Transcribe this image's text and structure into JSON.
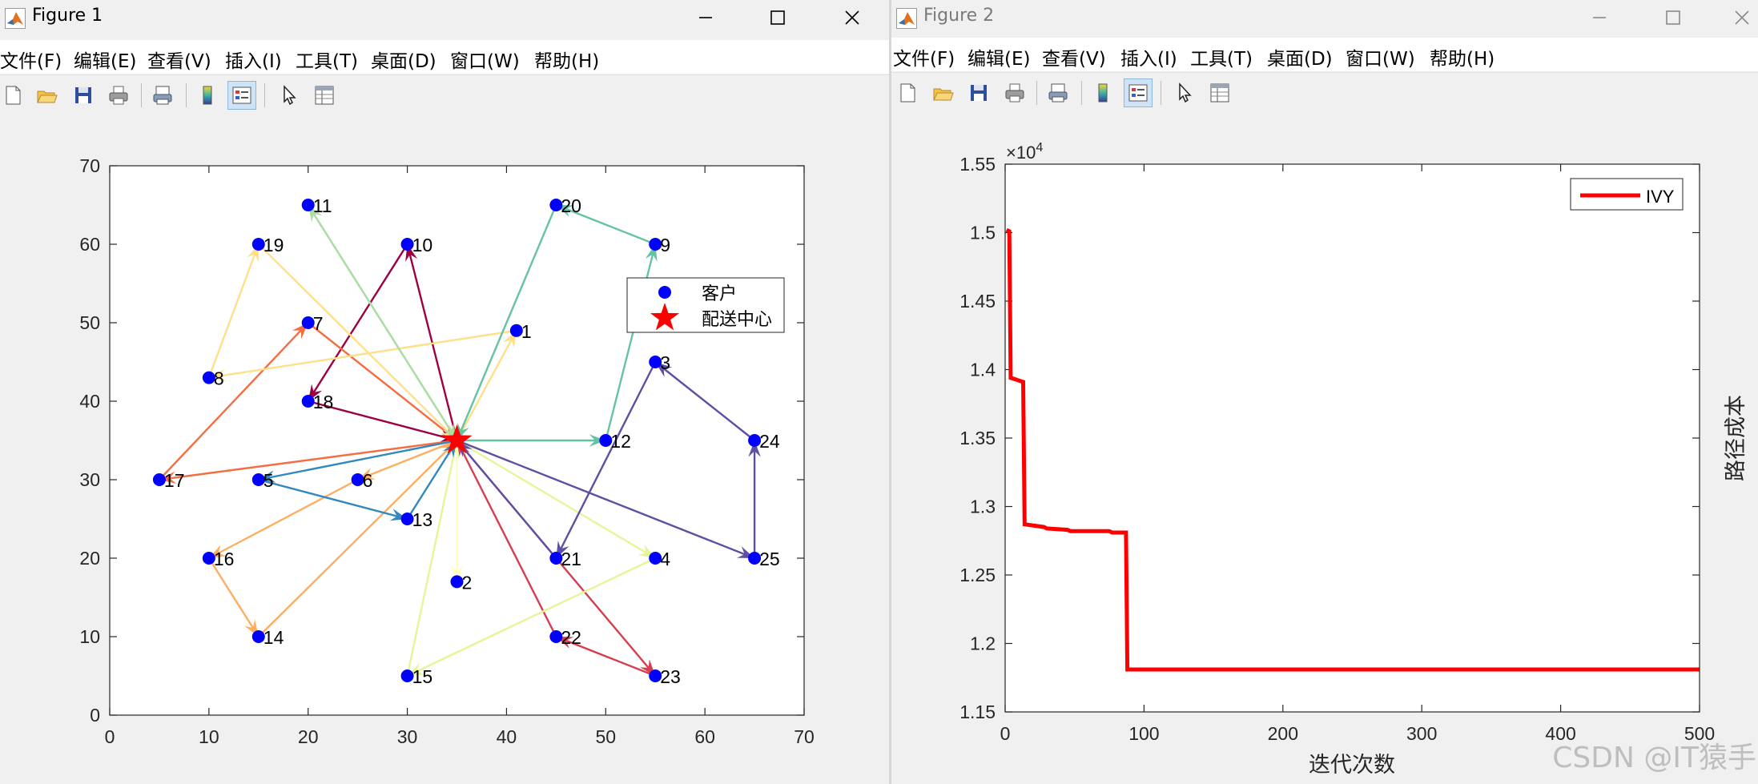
{
  "figure1": {
    "title": "Figure 1",
    "menu": [
      "文件(F)",
      "编辑(E)",
      "查看(V)",
      "插入(I)",
      "工具(T)",
      "桌面(D)",
      "窗口(W)",
      "帮助(H)"
    ],
    "toolbar": [
      "new-file",
      "open-file",
      "save",
      "print",
      "print-preview",
      "colorbar",
      "legend",
      "pointer",
      "property-inspector"
    ],
    "chart_data": {
      "type": "scatter",
      "xlim": [
        0,
        70
      ],
      "ylim": [
        0,
        70
      ],
      "xticks": [
        0,
        10,
        20,
        30,
        40,
        50,
        60,
        70
      ],
      "yticks": [
        0,
        10,
        20,
        30,
        40,
        50,
        60,
        70
      ],
      "grid": false,
      "legend": {
        "placement": "top-right",
        "entries": [
          "客户",
          "配送中心"
        ]
      },
      "depot": {
        "x": 35,
        "y": 35,
        "label": "配送中心",
        "color": "#ff0000",
        "marker": "pentagram"
      },
      "customers": [
        {
          "id": "1",
          "x": 41,
          "y": 49
        },
        {
          "id": "2",
          "x": 35,
          "y": 17
        },
        {
          "id": "3",
          "x": 55,
          "y": 45
        },
        {
          "id": "4",
          "x": 55,
          "y": 20
        },
        {
          "id": "5",
          "x": 15,
          "y": 30
        },
        {
          "id": "6",
          "x": 25,
          "y": 30
        },
        {
          "id": "7",
          "x": 20,
          "y": 50
        },
        {
          "id": "8",
          "x": 10,
          "y": 43
        },
        {
          "id": "9",
          "x": 55,
          "y": 60
        },
        {
          "id": "10",
          "x": 30,
          "y": 60
        },
        {
          "id": "11",
          "x": 20,
          "y": 65
        },
        {
          "id": "12",
          "x": 50,
          "y": 35
        },
        {
          "id": "13",
          "x": 30,
          "y": 25
        },
        {
          "id": "14",
          "x": 15,
          "y": 10
        },
        {
          "id": "15",
          "x": 30,
          "y": 5
        },
        {
          "id": "16",
          "x": 10,
          "y": 20
        },
        {
          "id": "17",
          "x": 5,
          "y": 30
        },
        {
          "id": "18",
          "x": 20,
          "y": 40
        },
        {
          "id": "19",
          "x": 15,
          "y": 60
        },
        {
          "id": "20",
          "x": 45,
          "y": 65
        },
        {
          "id": "21",
          "x": 45,
          "y": 20
        },
        {
          "id": "22",
          "x": 45,
          "y": 10
        },
        {
          "id": "23",
          "x": 55,
          "y": 5
        },
        {
          "id": "24",
          "x": 65,
          "y": 35
        },
        {
          "id": "25",
          "x": 65,
          "y": 20
        }
      ],
      "routes": [
        {
          "color": "#9e0142",
          "path": [
            "0",
            "10",
            "18",
            "0"
          ]
        },
        {
          "color": "#d53e4f",
          "path": [
            "0",
            "23",
            "22",
            "0"
          ]
        },
        {
          "color": "#f46d43",
          "path": [
            "0",
            "17",
            "7",
            "0"
          ]
        },
        {
          "color": "#fdae61",
          "path": [
            "0",
            "6",
            "16",
            "14",
            "0"
          ]
        },
        {
          "color": "#fee08b",
          "path": [
            "0",
            "1",
            "8",
            "19",
            "0"
          ]
        },
        {
          "color": "#e6f598",
          "path": [
            "0",
            "4",
            "15",
            "0"
          ]
        },
        {
          "color": "#abdda4",
          "path": [
            "0",
            "11",
            "0"
          ]
        },
        {
          "color": "#66c2a5",
          "path": [
            "0",
            "12",
            "9",
            "20",
            "0"
          ]
        },
        {
          "color": "#3288bd",
          "path": [
            "0",
            "5",
            "13",
            "0"
          ]
        },
        {
          "color": "#5e4fa2",
          "path": [
            "0",
            "25",
            "24",
            "3",
            "21",
            "0"
          ]
        },
        {
          "color": "#ffffbf",
          "path": [
            "0",
            "2"
          ]
        }
      ]
    }
  },
  "figure2": {
    "title": "Figure 2",
    "menu": [
      "文件(F)",
      "编辑(E)",
      "查看(V)",
      "插入(I)",
      "工具(T)",
      "桌面(D)",
      "窗口(W)",
      "帮助(H)"
    ],
    "toolbar": [
      "new-file",
      "open-file",
      "save",
      "print",
      "print-preview",
      "colorbar",
      "legend",
      "pointer",
      "property-inspector"
    ],
    "chart_data": {
      "type": "line",
      "xlabel": "迭代次数",
      "ylabel": "路径成本",
      "xlim": [
        0,
        500
      ],
      "ylim": [
        11500,
        15500
      ],
      "xticks": [
        0,
        100,
        200,
        300,
        400,
        500
      ],
      "yticks": [
        1.15,
        1.2,
        1.25,
        1.3,
        1.35,
        1.4,
        1.45,
        1.5,
        1.55
      ],
      "exponent_label": "×10",
      "exponent": "4",
      "legend": {
        "placement": "top-right",
        "entries": [
          "IVY"
        ]
      },
      "series": [
        {
          "name": "IVY",
          "color": "#ff0000",
          "x": [
            1,
            3,
            4,
            10,
            13,
            14,
            28,
            30,
            45,
            47,
            75,
            77,
            87,
            88,
            500
          ],
          "y": [
            15020,
            15010,
            13940,
            13920,
            13910,
            12870,
            12850,
            12840,
            12830,
            12820,
            12820,
            12810,
            12810,
            11810,
            11810
          ]
        }
      ]
    }
  },
  "watermark": "CSDN @IT猿手"
}
